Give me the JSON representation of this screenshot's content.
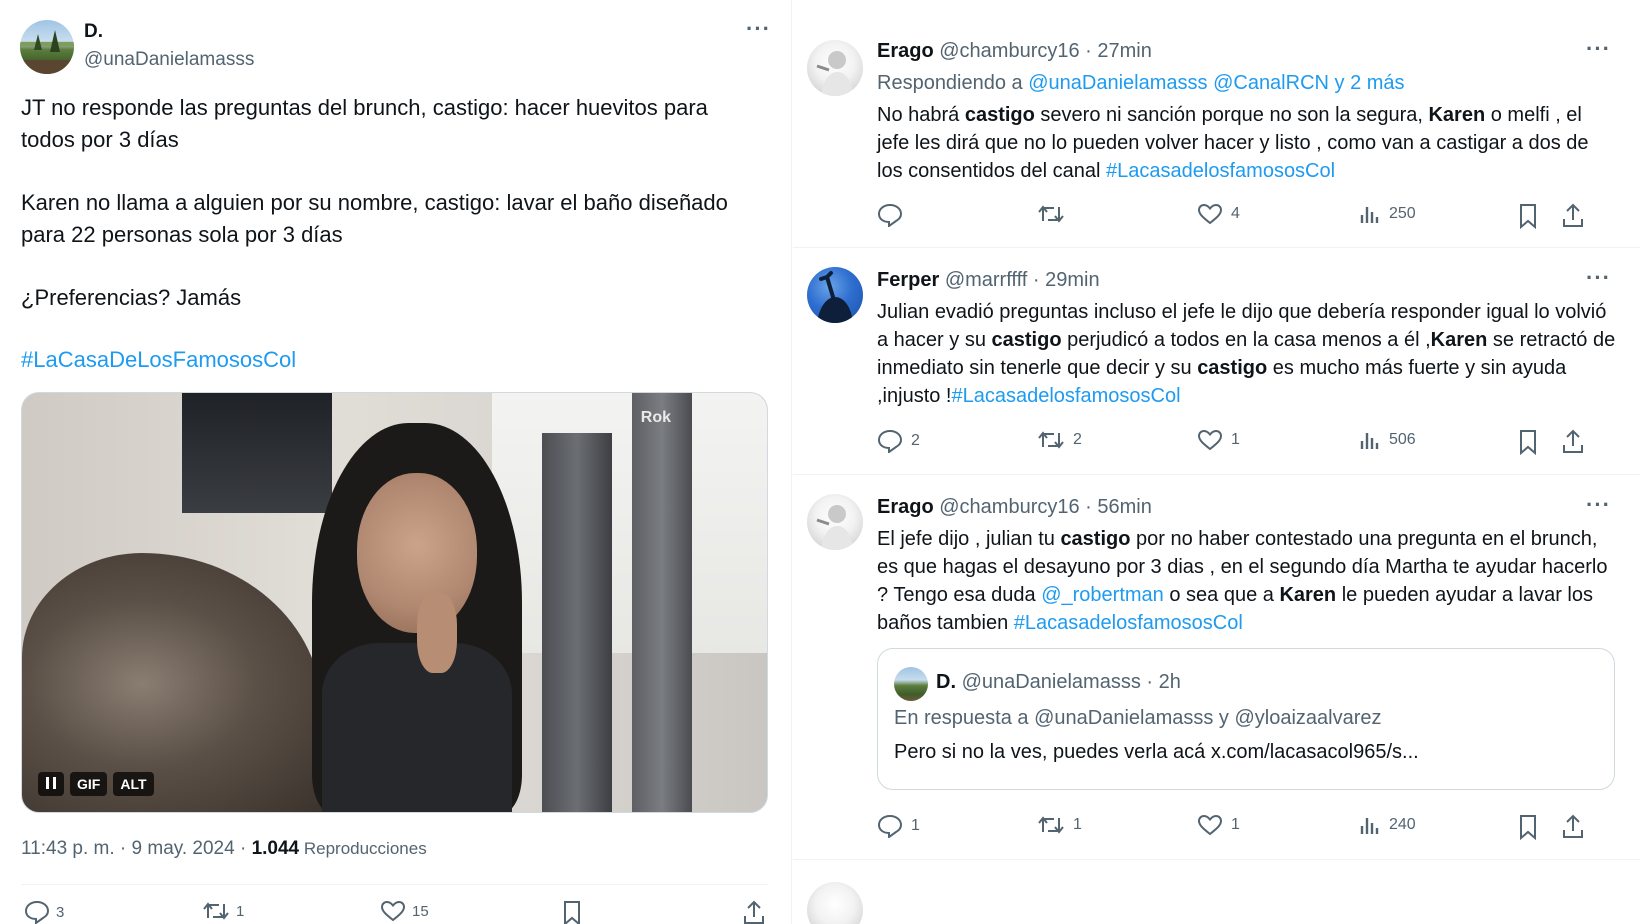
{
  "main_tweet": {
    "name": "D.",
    "handle": "@unaDanielamasss",
    "more_label": "···",
    "paragraphs": [
      "JT no responde las preguntas del brunch, castigo: hacer huevitos para todos por 3 días",
      "Karen no llama a alguien por su nombre, castigo: lavar el baño diseñado para 22 personas sola por 3 días",
      "¿Preferencias? Jamás"
    ],
    "hashtag": "#LaCasaDeLosFamososCol",
    "media": {
      "chips": [
        "GIF",
        "ALT"
      ],
      "watermark": "Rok"
    },
    "timestamp": "11:43 p. m. · 9 may. 2024 · ",
    "views": "1.044",
    "views_label": " Reproducciones",
    "actions": {
      "replies": "3",
      "reposts": "1",
      "likes": "15"
    }
  },
  "replies": [
    {
      "name": "Erago",
      "handle": "@chamburcy16",
      "time": " · 27min",
      "replying_label": "Respondiendo a ",
      "replying_to": "@unaDanielamasss @CanalRCN y 2 más",
      "text_segments": [
        {
          "t": "No habrá ",
          "s": "plain"
        },
        {
          "t": "castigo",
          "s": "bold"
        },
        {
          "t": " severo ni sanción porque no son la segura, ",
          "s": "plain"
        },
        {
          "t": "Karen",
          "s": "bold"
        },
        {
          "t": " o melfi , el jefe les dirá que no lo pueden volver hacer y listo , como van a castigar a dos de los consentidos del canal ",
          "s": "plain"
        },
        {
          "t": "#LacasadelosfamososCol",
          "s": "tag"
        }
      ],
      "stats": {
        "replies": "",
        "reposts": "",
        "likes": "4",
        "views": "250"
      }
    },
    {
      "name": "Ferper",
      "handle": "@marrffff",
      "time": " · 29min",
      "text_segments": [
        {
          "t": "Julian evadió preguntas incluso el jefe le dijo que debería responder igual lo volvió a hacer y su ",
          "s": "plain"
        },
        {
          "t": "castigo",
          "s": "bold"
        },
        {
          "t": " perjudicó a todos en la casa menos a él ,",
          "s": "plain"
        },
        {
          "t": "Karen",
          "s": "bold"
        },
        {
          "t": " se retractó de inmediato sin tenerle que decir y su ",
          "s": "plain"
        },
        {
          "t": "castigo",
          "s": "bold"
        },
        {
          "t": " es mucho más fuerte y sin ayuda ,injusto !",
          "s": "plain"
        },
        {
          "t": "#LacasadelosfamososCol",
          "s": "tag"
        }
      ],
      "stats": {
        "replies": "2",
        "reposts": "2",
        "likes": "1",
        "views": "506"
      }
    },
    {
      "name": "Erago",
      "handle": "@chamburcy16",
      "time": " · 56min",
      "text_segments": [
        {
          "t": "El jefe dijo , julian tu ",
          "s": "plain"
        },
        {
          "t": "castigo",
          "s": "bold"
        },
        {
          "t": " por no haber contestado una pregunta en el brunch, es que hagas el desayuno por 3 dias , en el segundo día Martha te ayudar hacerlo ? Tengo esa duda ",
          "s": "plain"
        },
        {
          "t": "@_robertman",
          "s": "tag"
        },
        {
          "t": " o sea que a ",
          "s": "plain"
        },
        {
          "t": "Karen",
          "s": "bold"
        },
        {
          "t": " le pueden ayudar a lavar los baños tambien ",
          "s": "plain"
        },
        {
          "t": "#LacasadelosfamososCol",
          "s": "tag"
        }
      ],
      "quote": {
        "name": "D.",
        "handle": "@unaDanielamasss",
        "time": " · 2h",
        "in_reply_label": "En respuesta a @unaDanielamasss y @yloaizaalvarez",
        "text": "Pero si no la ves, puedes verla acá x.com/lacasacol965/s..."
      },
      "stats": {
        "replies": "1",
        "reposts": "1",
        "likes": "1",
        "views": "240"
      }
    }
  ],
  "colors": {
    "accent": "#1d9bf0",
    "secondary_text": "#536471",
    "primary_text": "#0f1419",
    "border": "#eff3f4"
  },
  "icons": [
    "reply-icon",
    "repost-icon",
    "like-icon",
    "views-icon",
    "bookmark-icon",
    "share-icon",
    "more-icon",
    "pause-icon"
  ]
}
